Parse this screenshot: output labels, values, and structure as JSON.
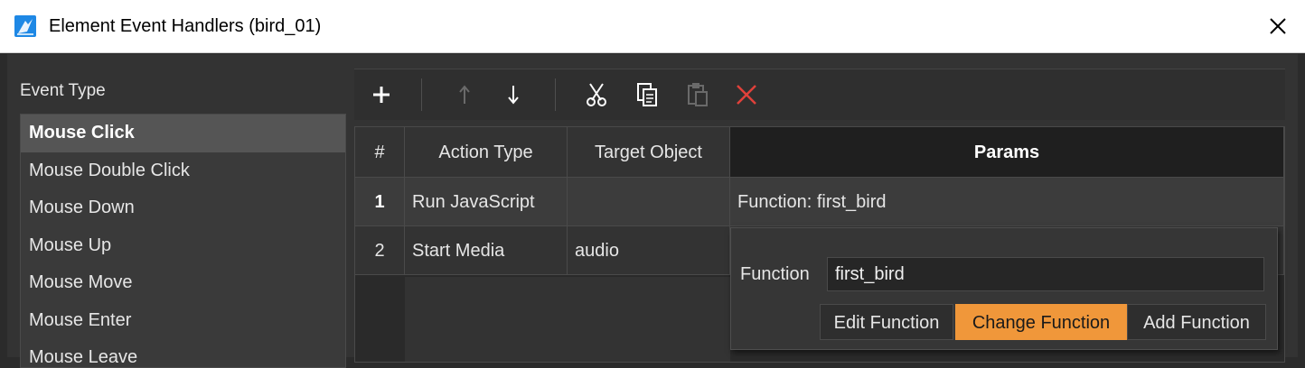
{
  "window": {
    "title": "Element Event Handlers (bird_01)"
  },
  "event_panel": {
    "label": "Event Type",
    "items": [
      "Mouse Click",
      "Mouse Double Click",
      "Mouse Down",
      "Mouse Up",
      "Mouse Move",
      "Mouse Enter",
      "Mouse Leave"
    ],
    "selected": "Mouse Click"
  },
  "toolbar": {
    "buttons": [
      "add-icon",
      "move-up-icon",
      "move-down-icon",
      "cut-icon",
      "copy-icon",
      "paste-icon",
      "delete-icon"
    ],
    "disabled": [
      "move-up-icon",
      "paste-icon"
    ]
  },
  "grid": {
    "headers": {
      "num": "#",
      "action": "Action Type",
      "target": "Target Object",
      "params": "Params"
    },
    "rows": [
      {
        "num": "1",
        "action": "Run JavaScript",
        "target": "",
        "params": "Function: first_bird"
      },
      {
        "num": "2",
        "action": "Start Media",
        "target": "audio",
        "params": ""
      }
    ]
  },
  "popup": {
    "function_label": "Function",
    "function_value": "first_bird",
    "buttons": {
      "edit": "Edit Function",
      "change": "Change Function",
      "add": "Add Function"
    },
    "active_button": "Change Function"
  },
  "colors": {
    "accent": "#f0973a",
    "delete": "#e0413a",
    "app_icon": "#1e88e5"
  }
}
